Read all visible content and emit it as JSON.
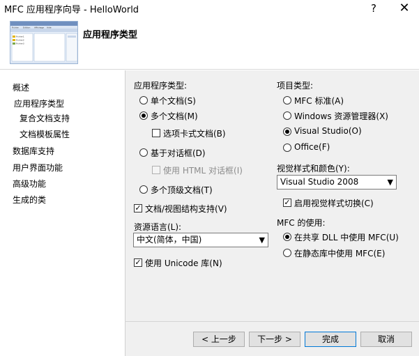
{
  "window": {
    "title": "MFC 应用程序向导 - HelloWorld",
    "help_glyph": "?",
    "close_glyph": "✕"
  },
  "header": {
    "title": "应用程序类型"
  },
  "nav": {
    "items": [
      {
        "label": "概述"
      },
      {
        "label": "应用程序类型",
        "selected": true
      },
      {
        "label": "复合文档支持"
      },
      {
        "label": "文档模板属性"
      },
      {
        "label": "数据库支持"
      },
      {
        "label": "用户界面功能"
      },
      {
        "label": "高级功能"
      },
      {
        "label": "生成的类"
      }
    ]
  },
  "app_type": {
    "heading": "应用程序类型:",
    "single_doc": "单个文档(S)",
    "multi_doc": "多个文档(M)",
    "tabbed_docs": "选项卡式文档(B)",
    "dialog_based": "基于对话框(D)",
    "html_dialog": "使用 HTML 对话框(I)",
    "multi_toplevel": "多个顶级文档(T)",
    "selected": "multi_doc"
  },
  "doc_view": {
    "label": "文档/视图结构支持(V)",
    "checked": true
  },
  "resource_lang": {
    "label": "资源语言(L):",
    "value": "中文(简体，中国)"
  },
  "unicode": {
    "label": "使用 Unicode 库(N)",
    "checked": true
  },
  "project_type": {
    "heading": "项目类型:",
    "mfc_standard": "MFC 标准(A)",
    "explorer": "Windows 资源管理器(X)",
    "visual_studio": "Visual Studio(O)",
    "office": "Office(F)",
    "selected": "visual_studio"
  },
  "visual_style": {
    "label": "视觉样式和颜色(Y):",
    "value": "Visual Studio 2008",
    "switch_label": "启用视觉样式切换(C)",
    "switch_checked": true
  },
  "mfc_use": {
    "heading": "MFC 的使用:",
    "shared": "在共享 DLL 中使用 MFC(U)",
    "static": "在静态库中使用 MFC(E)",
    "selected": "shared"
  },
  "buttons": {
    "prev": "< 上一步",
    "next": "下一步 >",
    "finish": "完成",
    "cancel": "取消"
  },
  "thumbnail": {
    "menu": [
      "Fichier",
      "Edition",
      "Affichage",
      "Aide"
    ],
    "left_items": [
      "Fichier1",
      "Fichier2",
      "Fichier3"
    ]
  },
  "colors": {
    "accent": "#0078d7",
    "panel_bg": "#f0f0f0"
  }
}
